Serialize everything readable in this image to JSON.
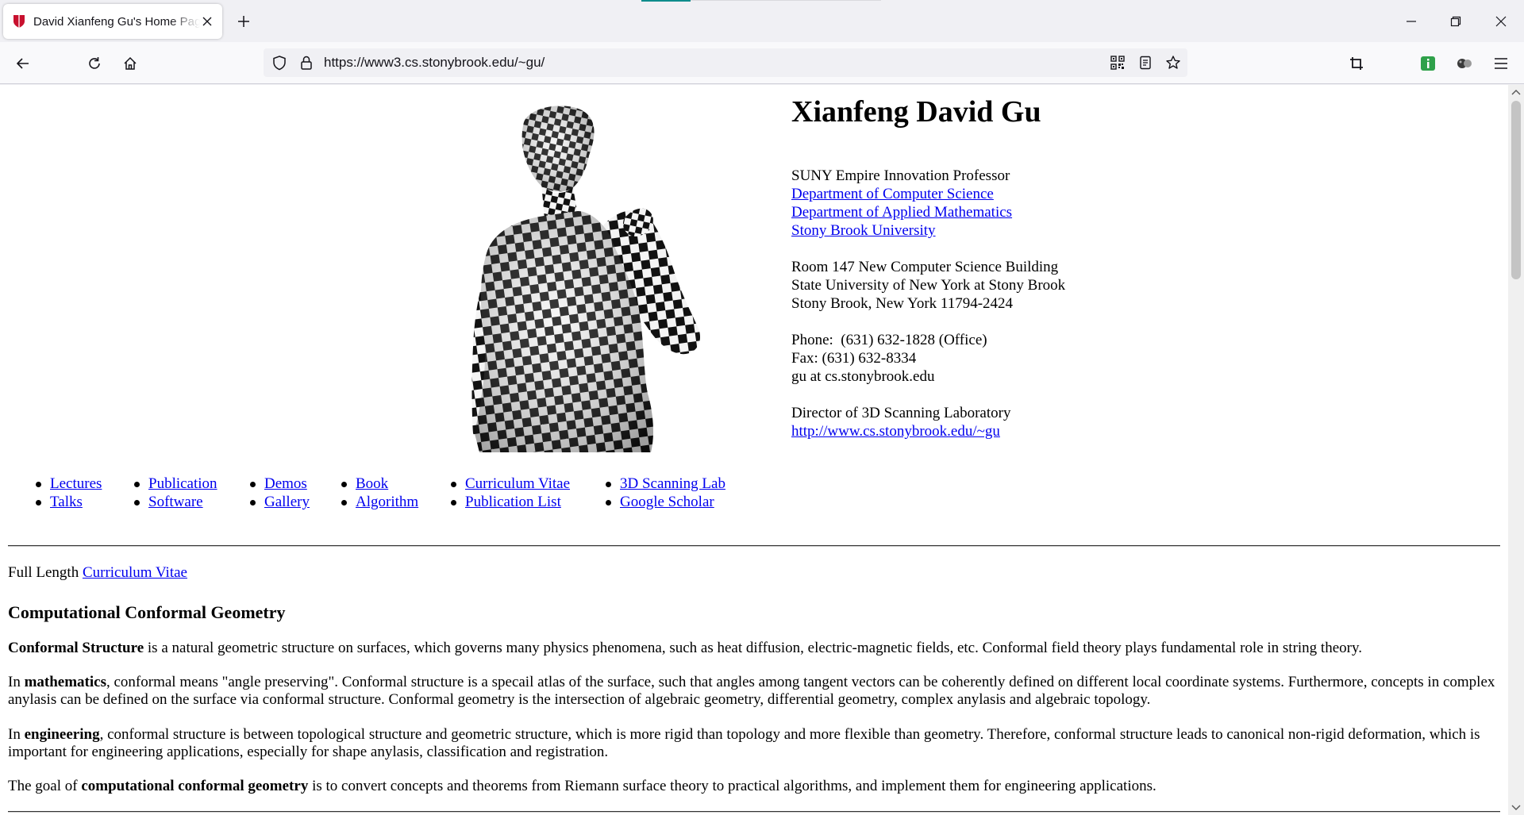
{
  "browser": {
    "tab_title": "David Xianfeng Gu's Home Page",
    "url": "https://www3.cs.stonybrook.edu/~gu/",
    "accent_color": "#0e8c8c"
  },
  "header": {
    "name": "Xianfeng David Gu",
    "title": "SUNY Empire Innovation Professor",
    "dept_cs": "Department of Computer Science",
    "dept_am": "Department of Applied Mathematics",
    "university": "Stony Brook University",
    "room": "Room 147 New Computer Science Building",
    "state_univ": "State University of New York at Stony Brook",
    "city": "Stony Brook, New York 11794-2424",
    "phone": "Phone:  (631) 632-1828 (Office)",
    "fax": "Fax: (631) 632-8334",
    "email": "gu at cs.stonybrook.edu",
    "director": "Director of 3D Scanning Laboratory",
    "lab_url": "http://www.cs.stonybrook.edu/~gu"
  },
  "nav_columns": [
    [
      "Lectures",
      "Talks"
    ],
    [
      "Publication",
      "Software"
    ],
    [
      "Demos",
      "Gallery"
    ],
    [
      "Book",
      "Algorithm"
    ],
    [
      "Curriculum Vitae",
      "Publication List"
    ],
    [
      "3D Scanning Lab",
      "Google Scholar"
    ]
  ],
  "cv_line": {
    "prefix": "Full Length ",
    "link": "Curriculum Vitae"
  },
  "section": {
    "heading": "Computational Conformal Geometry",
    "p1_bold": "Conformal Structure",
    "p1_rest": " is a natural geometric structure on surfaces, which governs many physics phenomena, such as heat diffusion, electric-magnetic fields, etc. Conformal field theory plays fundamental role in string theory.",
    "p2_pre": "In ",
    "p2_bold": "mathematics",
    "p2_rest": ", conformal means \"angle preserving\". Conformal structure is a specail atlas of the surface, such that angles among tangent vectors can be coherently defined on different local coordinate systems. Furthermore, concepts in complex anylasis can be defined on the surface via conformal structure. Conformal geometry is the intersection of algebraic geometry, differential geometry, complex anylasis and algebraic topology.",
    "p3_pre": "In ",
    "p3_bold": "engineering",
    "p3_rest": ", conformal structure is between topological structure and geometric structure, which is more rigid than topology and more flexible than geometry. Therefore, conformal structure leads to canonical non-rigid deformation, which is important for engineering applications, especially for shape anylasis, classification and registration.",
    "p4_pre": "The goal of ",
    "p4_bold": "computational conformal geometry",
    "p4_rest": " is to convert concepts and theorems from Riemann surface theory to practical algorithms, and implement them for engineering applications."
  }
}
